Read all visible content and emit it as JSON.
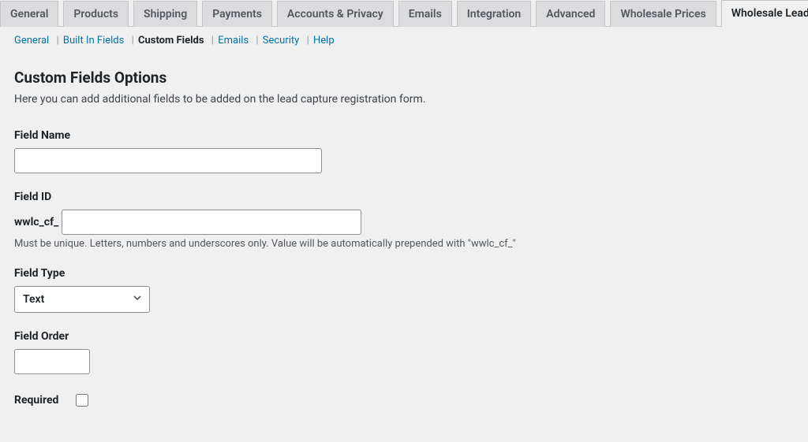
{
  "tabs": {
    "items": [
      "General",
      "Products",
      "Shipping",
      "Payments",
      "Accounts & Privacy",
      "Emails",
      "Integration",
      "Advanced",
      "Wholesale Prices",
      "Wholesale Lead"
    ],
    "active_index": 9
  },
  "subnav": {
    "items": [
      "General",
      "Built In Fields",
      "Custom Fields",
      "Emails",
      "Security",
      "Help"
    ],
    "active_index": 2
  },
  "section": {
    "title": "Custom Fields Options",
    "description": "Here you can add additional fields to be added on the lead capture registration form."
  },
  "form": {
    "field_name": {
      "label": "Field Name",
      "value": ""
    },
    "field_id": {
      "label": "Field ID",
      "prefix": "wwlc_cf_",
      "value": "",
      "hint": "Must be unique. Letters, numbers and underscores only. Value will be automatically prepended with \"wwlc_cf_\""
    },
    "field_type": {
      "label": "Field Type",
      "value": "Text"
    },
    "field_order": {
      "label": "Field Order",
      "value": ""
    },
    "required": {
      "label": "Required",
      "checked": false
    }
  }
}
